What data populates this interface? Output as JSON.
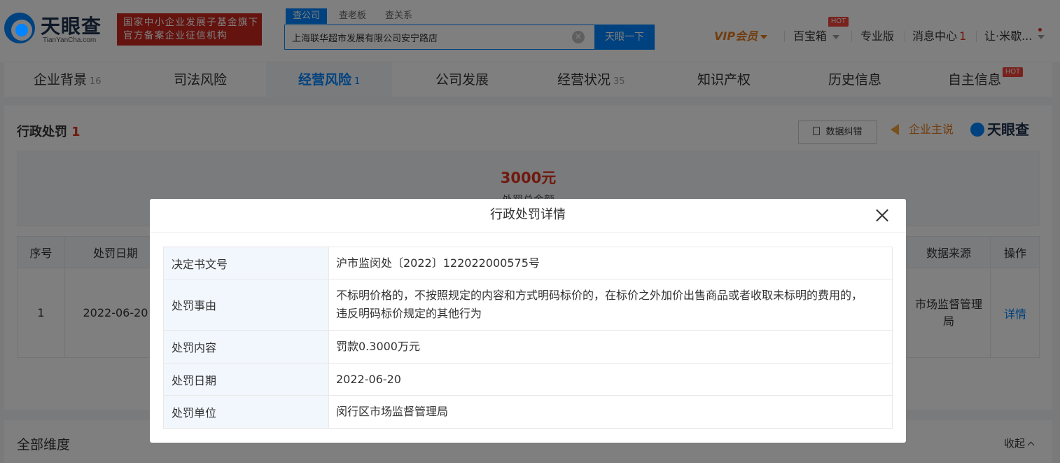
{
  "header": {
    "logo_text": "天眼查",
    "logo_sub": "TianYanCha.com",
    "gov_badge_line1": "国家中小企业发展子基金旗下",
    "gov_badge_line2": "官方备案企业征信机构",
    "search_tabs": [
      "查公司",
      "查老板",
      "查关系"
    ],
    "search_value": "上海联华超市发展有限公司安宁路店",
    "search_button": "天眼一下",
    "vip": "VIP会员",
    "baibao": "百宝箱",
    "hot": "HOT",
    "pro": "专业版",
    "messages": "消息中心",
    "messages_count": "1",
    "user": "让·米歇..."
  },
  "categories": [
    {
      "label": "企业背景",
      "count": "16"
    },
    {
      "label": "司法风险",
      "count": ""
    },
    {
      "label": "经营风险",
      "count": "1"
    },
    {
      "label": "公司发展",
      "count": ""
    },
    {
      "label": "经营状况",
      "count": "35"
    },
    {
      "label": "知识产权",
      "count": ""
    },
    {
      "label": "历史信息",
      "count": ""
    },
    {
      "label": "自主信息",
      "count": ""
    }
  ],
  "category_hot": "HOT",
  "section": {
    "title": "行政处罚",
    "count": "1",
    "correct_button": "数据纠错",
    "company_say": "企业主说",
    "brand": "天眼查",
    "summary_amount": "3000元",
    "summary_label": "处罚总金额"
  },
  "table": {
    "headers": [
      "序号",
      "处罚日期",
      "数据来源",
      "操作"
    ],
    "rows": [
      {
        "index": "1",
        "date": "2022-06-20",
        "source": "市场监督管理局",
        "action": "详情"
      }
    ]
  },
  "bottom": {
    "title": "全部维度",
    "collapse": "收起"
  },
  "modal": {
    "title": "行政处罚详情",
    "rows": [
      {
        "label": "决定书文号",
        "value": "沪市监闵处〔2022〕122022000575号"
      },
      {
        "label": "处罚事由",
        "value": "不标明价格的，不按照规定的内容和方式明码标价的，在标价之外加价出售商品或者收取未标明的费用的，违反明码标价规定的其他行为"
      },
      {
        "label": "处罚内容",
        "value": "罚款0.3000万元"
      },
      {
        "label": "处罚日期",
        "value": "2022-06-20"
      },
      {
        "label": "处罚单位",
        "value": "闵行区市场监督管理局"
      }
    ]
  },
  "colors": {
    "brand_blue": "#0084ff",
    "accent_red": "#e0331d",
    "vip_orange": "#e37b1e"
  }
}
